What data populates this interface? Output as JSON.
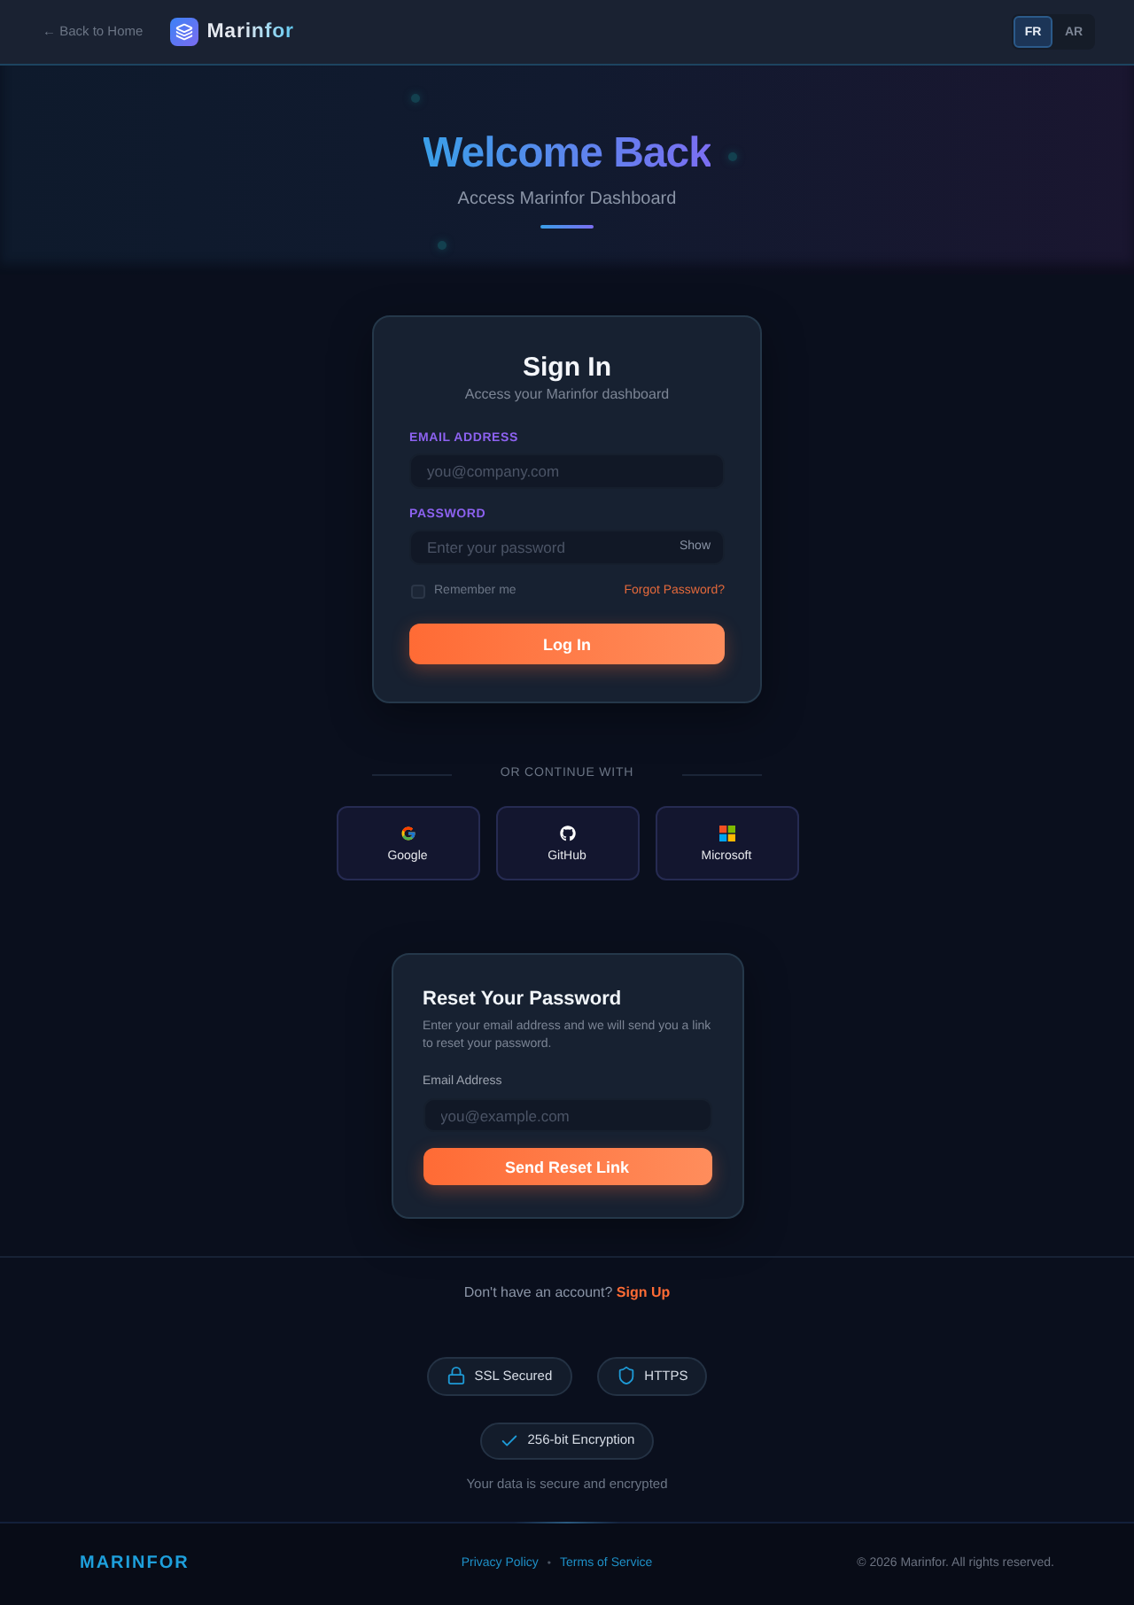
{
  "header": {
    "back_link": "← Back to Home",
    "brand": "Marinfor",
    "languages": [
      {
        "label": "FR",
        "selected": true
      },
      {
        "label": "AR",
        "selected": false
      }
    ]
  },
  "hero": {
    "title": "Welcome Back",
    "subtitle": "Access Marinfor Dashboard"
  },
  "sign_in": {
    "title": "Sign In",
    "subtitle": "Access your Marinfor dashboard",
    "fields": [
      {
        "label": "EMAIL ADDRESS",
        "placeholder": "you@company.com"
      },
      {
        "label": "PASSWORD",
        "placeholder": "Enter your password",
        "toggle": "Show"
      }
    ],
    "remember": {
      "label": "Remember me",
      "checked": false
    },
    "forgot_link": "Forgot Password?",
    "submit": "Log In"
  },
  "social": {
    "divider": "OR CONTINUE WITH",
    "providers": [
      {
        "kind": "google",
        "label": "Google"
      },
      {
        "kind": "github",
        "label": "GitHub"
      },
      {
        "kind": "microsoft",
        "label": "Microsoft"
      }
    ]
  },
  "reset": {
    "title": "Reset Your Password",
    "description": "Enter your email address and we will send you a link to reset your password.",
    "field": {
      "label": "Email Address",
      "placeholder": "you@example.com"
    },
    "submit": "Send Reset Link"
  },
  "signup": {
    "prompt": "Don't have an account?",
    "link": "Sign Up"
  },
  "security": {
    "badges": [
      {
        "kind": "lock",
        "label": "SSL Secured"
      },
      {
        "kind": "shield",
        "label": "HTTPS"
      },
      {
        "kind": "check",
        "label": "256-bit Encryption"
      }
    ],
    "note": "Your data is secure and encrypted"
  },
  "footer": {
    "brand": "MARINFOR",
    "links": [
      "Privacy Policy",
      "Terms of Service"
    ],
    "separator": "•",
    "copyright": "© 2026 Marinfor. All rights reserved."
  }
}
